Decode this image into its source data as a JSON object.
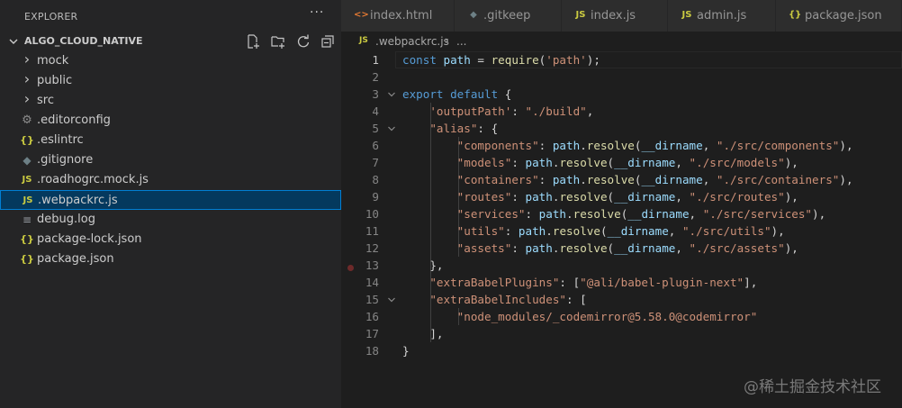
{
  "sidebar": {
    "title": "EXPLORER",
    "more_label": "···",
    "project": "ALGO_CLOUD_NATIVE",
    "project_actions": [
      "new-file-icon",
      "new-folder-icon",
      "refresh-icon",
      "collapse-all-icon"
    ],
    "items": [
      {
        "label": "mock",
        "icon": "chevron-right-icon",
        "glyph": "›",
        "type": "folder"
      },
      {
        "label": "public",
        "icon": "chevron-right-icon",
        "glyph": "›",
        "type": "folder"
      },
      {
        "label": "src",
        "icon": "chevron-right-icon",
        "glyph": "›",
        "type": "folder"
      },
      {
        "label": ".editorconfig",
        "icon": "gear-icon",
        "glyph": "⚙",
        "type": "file"
      },
      {
        "label": ".eslintrc",
        "icon": "json-icon",
        "glyph": "{}",
        "type": "file"
      },
      {
        "label": ".gitignore",
        "icon": "git-icon",
        "glyph": "◆",
        "type": "file"
      },
      {
        "label": ".roadhogrc.mock.js",
        "icon": "js-icon",
        "glyph": "JS",
        "type": "file"
      },
      {
        "label": ".webpackrc.js",
        "icon": "js-icon",
        "glyph": "JS",
        "type": "file",
        "selected": true
      },
      {
        "label": "debug.log",
        "icon": "log-icon",
        "glyph": "≡",
        "type": "file"
      },
      {
        "label": "package-lock.json",
        "icon": "json-icon",
        "glyph": "{}",
        "type": "file"
      },
      {
        "label": "package.json",
        "icon": "json-icon",
        "glyph": "{}",
        "type": "file"
      }
    ]
  },
  "tabs": [
    {
      "label": "index.html",
      "icon": "html-icon",
      "glyph": "<>",
      "color": "#e37933"
    },
    {
      "label": ".gitkeep",
      "icon": "git-icon",
      "glyph": "◆",
      "color": "#6d8086"
    },
    {
      "label": "index.js",
      "icon": "js-icon",
      "glyph": "JS",
      "color": "#cbcb41"
    },
    {
      "label": "admin.js",
      "icon": "js-icon",
      "glyph": "JS",
      "color": "#cbcb41"
    },
    {
      "label": "package.json",
      "icon": "json-icon",
      "glyph": "{}",
      "color": "#cbcb41"
    }
  ],
  "breadcrumb": {
    "icon": "JS",
    "file": ".webpackrc.js",
    "separator": "›",
    "more": "..."
  },
  "code": {
    "active_line": 1,
    "lines": [
      {
        "n": "1",
        "tokens": [
          [
            "kw",
            "const "
          ],
          [
            "var",
            "path"
          ],
          [
            "pl",
            " = "
          ],
          [
            "fn",
            "require"
          ],
          [
            "pl",
            "("
          ],
          [
            "str",
            "'path'"
          ],
          [
            "pl",
            ");"
          ]
        ]
      },
      {
        "n": "2",
        "tokens": []
      },
      {
        "n": "3",
        "tokens": [
          [
            "kw",
            "export default"
          ],
          [
            "pl",
            " {"
          ]
        ],
        "fold": true
      },
      {
        "n": "4",
        "tokens": [
          [
            "pl",
            "    "
          ],
          [
            "str",
            "'outputPath'"
          ],
          [
            "pl",
            ": "
          ],
          [
            "str",
            "\"./build\""
          ],
          [
            "pl",
            ","
          ]
        ]
      },
      {
        "n": "5",
        "tokens": [
          [
            "pl",
            "    "
          ],
          [
            "str",
            "\"alias\""
          ],
          [
            "pl",
            ": {"
          ]
        ],
        "fold": true
      },
      {
        "n": "6",
        "tokens": [
          [
            "pl",
            "        "
          ],
          [
            "str",
            "\"components\""
          ],
          [
            "pl",
            ": "
          ],
          [
            "var",
            "path"
          ],
          [
            "pl",
            "."
          ],
          [
            "fn",
            "resolve"
          ],
          [
            "pl",
            "("
          ],
          [
            "var",
            "__dirname"
          ],
          [
            "pl",
            ", "
          ],
          [
            "str",
            "\"./src/components\""
          ],
          [
            "pl",
            "),"
          ]
        ]
      },
      {
        "n": "7",
        "tokens": [
          [
            "pl",
            "        "
          ],
          [
            "str",
            "\"models\""
          ],
          [
            "pl",
            ": "
          ],
          [
            "var",
            "path"
          ],
          [
            "pl",
            "."
          ],
          [
            "fn",
            "resolve"
          ],
          [
            "pl",
            "("
          ],
          [
            "var",
            "__dirname"
          ],
          [
            "pl",
            ", "
          ],
          [
            "str",
            "\"./src/models\""
          ],
          [
            "pl",
            "),"
          ]
        ]
      },
      {
        "n": "8",
        "tokens": [
          [
            "pl",
            "        "
          ],
          [
            "str",
            "\"containers\""
          ],
          [
            "pl",
            ": "
          ],
          [
            "var",
            "path"
          ],
          [
            "pl",
            "."
          ],
          [
            "fn",
            "resolve"
          ],
          [
            "pl",
            "("
          ],
          [
            "var",
            "__dirname"
          ],
          [
            "pl",
            ", "
          ],
          [
            "str",
            "\"./src/containers\""
          ],
          [
            "pl",
            "),"
          ]
        ]
      },
      {
        "n": "9",
        "tokens": [
          [
            "pl",
            "        "
          ],
          [
            "str",
            "\"routes\""
          ],
          [
            "pl",
            ": "
          ],
          [
            "var",
            "path"
          ],
          [
            "pl",
            "."
          ],
          [
            "fn",
            "resolve"
          ],
          [
            "pl",
            "("
          ],
          [
            "var",
            "__dirname"
          ],
          [
            "pl",
            ", "
          ],
          [
            "str",
            "\"./src/routes\""
          ],
          [
            "pl",
            "),"
          ]
        ]
      },
      {
        "n": "10",
        "tokens": [
          [
            "pl",
            "        "
          ],
          [
            "str",
            "\"services\""
          ],
          [
            "pl",
            ": "
          ],
          [
            "var",
            "path"
          ],
          [
            "pl",
            "."
          ],
          [
            "fn",
            "resolve"
          ],
          [
            "pl",
            "("
          ],
          [
            "var",
            "__dirname"
          ],
          [
            "pl",
            ", "
          ],
          [
            "str",
            "\"./src/services\""
          ],
          [
            "pl",
            "),"
          ]
        ]
      },
      {
        "n": "11",
        "tokens": [
          [
            "pl",
            "        "
          ],
          [
            "str",
            "\"utils\""
          ],
          [
            "pl",
            ": "
          ],
          [
            "var",
            "path"
          ],
          [
            "pl",
            "."
          ],
          [
            "fn",
            "resolve"
          ],
          [
            "pl",
            "("
          ],
          [
            "var",
            "__dirname"
          ],
          [
            "pl",
            ", "
          ],
          [
            "str",
            "\"./src/utils\""
          ],
          [
            "pl",
            "),"
          ]
        ]
      },
      {
        "n": "12",
        "tokens": [
          [
            "pl",
            "        "
          ],
          [
            "str",
            "\"assets\""
          ],
          [
            "pl",
            ": "
          ],
          [
            "var",
            "path"
          ],
          [
            "pl",
            "."
          ],
          [
            "fn",
            "resolve"
          ],
          [
            "pl",
            "("
          ],
          [
            "var",
            "__dirname"
          ],
          [
            "pl",
            ", "
          ],
          [
            "str",
            "\"./src/assets\""
          ],
          [
            "pl",
            "),"
          ]
        ]
      },
      {
        "n": "13",
        "tokens": [
          [
            "pl",
            "    },"
          ]
        ]
      },
      {
        "n": "14",
        "tokens": [
          [
            "pl",
            "    "
          ],
          [
            "str",
            "\"extraBabelPlugins\""
          ],
          [
            "pl",
            ": ["
          ],
          [
            "str",
            "\"@ali/babel-plugin-next\""
          ],
          [
            "pl",
            "],"
          ]
        ]
      },
      {
        "n": "15",
        "tokens": [
          [
            "pl",
            "    "
          ],
          [
            "str",
            "\"extraBabelIncludes\""
          ],
          [
            "pl",
            ": ["
          ]
        ],
        "fold": true
      },
      {
        "n": "16",
        "tokens": [
          [
            "pl",
            "        "
          ],
          [
            "str",
            "\"node_modules/_codemirror@5.58.0@codemirror\""
          ]
        ]
      },
      {
        "n": "17",
        "tokens": [
          [
            "pl",
            "    ],"
          ]
        ]
      },
      {
        "n": "18",
        "tokens": [
          [
            "pl",
            "}"
          ]
        ]
      }
    ]
  },
  "watermark": "@稀土掘金技术社区"
}
